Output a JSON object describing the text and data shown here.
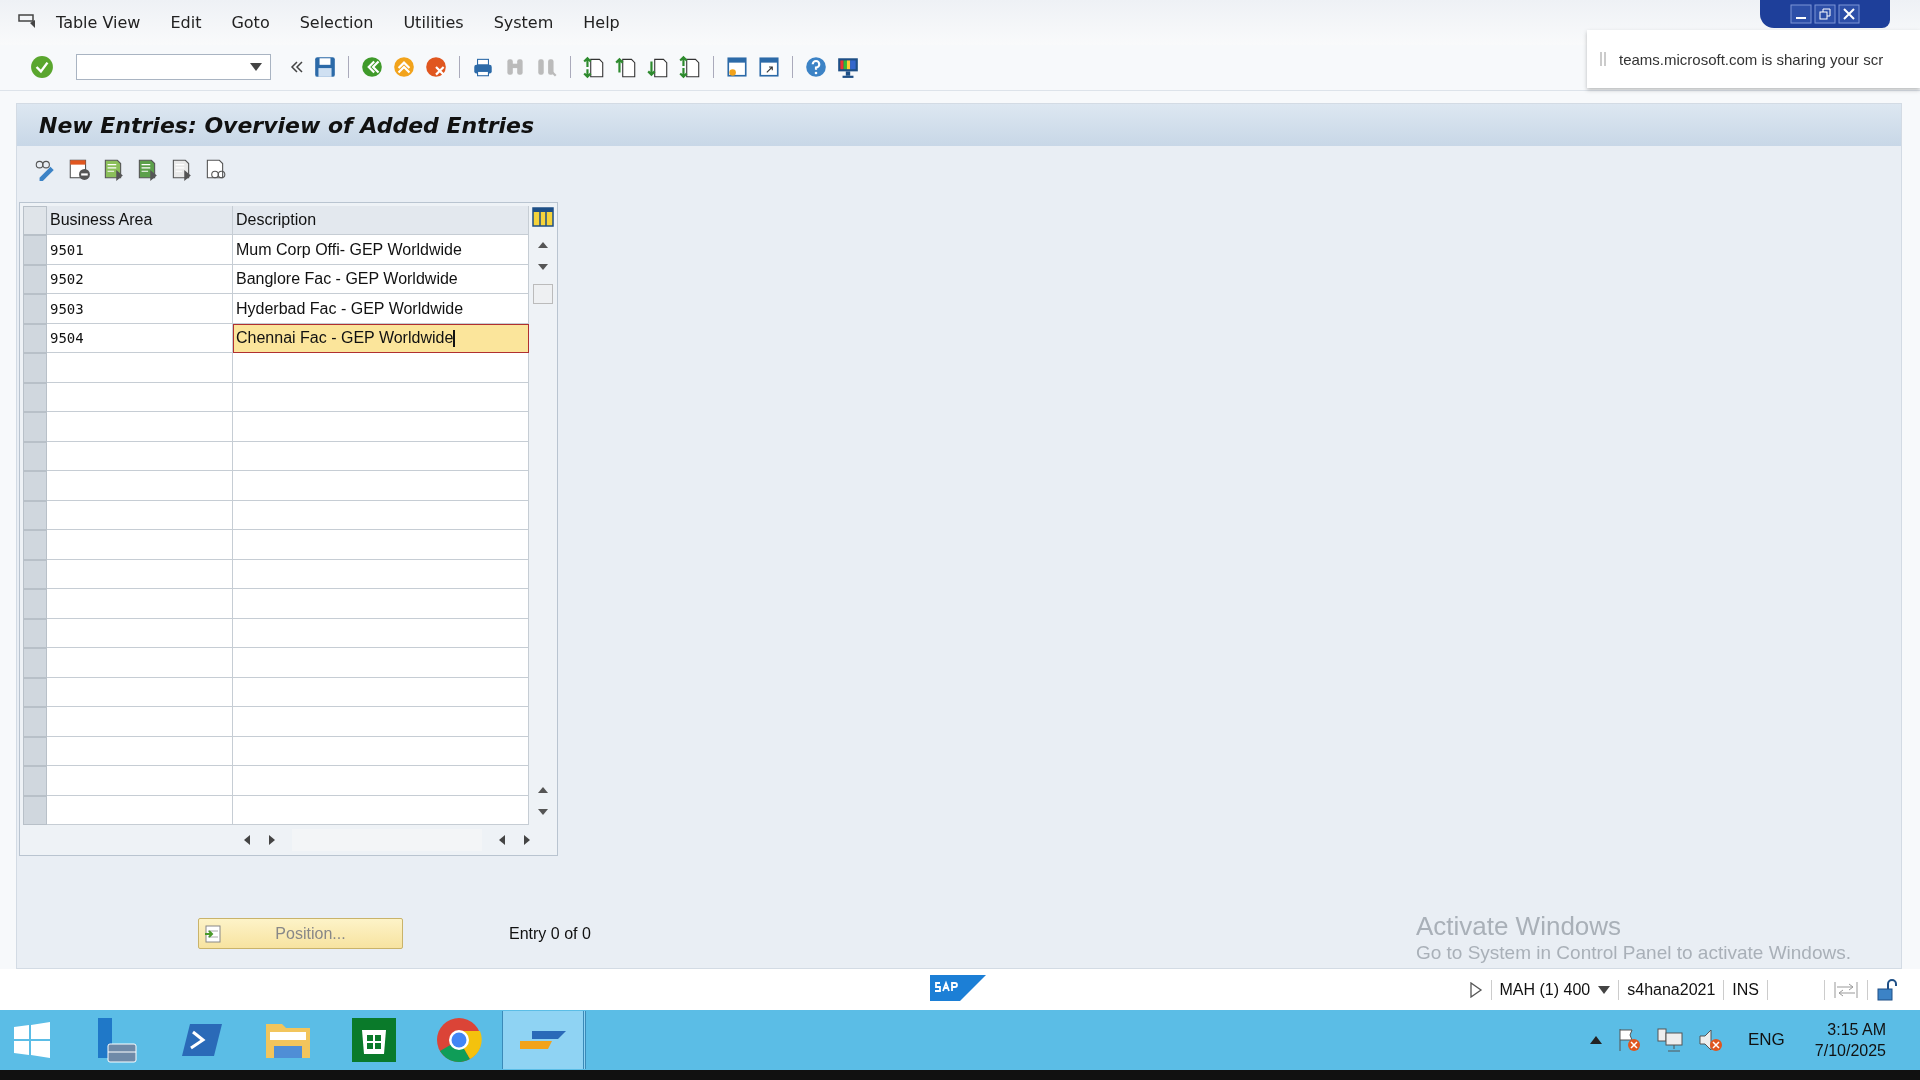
{
  "menu": [
    {
      "label": "Table View"
    },
    {
      "label": "Edit"
    },
    {
      "label": "Goto"
    },
    {
      "label": "Selection"
    },
    {
      "label": "Utilities"
    },
    {
      "label": "System"
    },
    {
      "label": "Help"
    }
  ],
  "screen_title": "New Entries: Overview of Added Entries",
  "table": {
    "columns": [
      "Business Area",
      "Description"
    ],
    "rows": [
      {
        "business_area": "9501",
        "description": "Mum Corp Offi- GEP Worldwide",
        "editing": false
      },
      {
        "business_area": "9502",
        "description": "Banglore Fac - GEP Worldwide",
        "editing": false
      },
      {
        "business_area": "9503",
        "description": "Hyderbad Fac - GEP Worldwide",
        "editing": false
      },
      {
        "business_area": "9504",
        "description": "Chennai Fac - GEP Worldwide",
        "editing": true
      }
    ]
  },
  "position_button": "Position...",
  "entry_count": "Entry 0 of 0",
  "activation_notice": {
    "title": "Activate Windows",
    "text": "Go to System in Control Panel to activate Windows."
  },
  "status_bar": {
    "system": "MAH (1) 400",
    "server": "s4hana2021",
    "mode": "INS"
  },
  "sharing_notice": "teams.microsoft.com is sharing your scr",
  "taskbar": {
    "language": "ENG",
    "time": "3:15 AM",
    "date": "7/10/2025"
  }
}
